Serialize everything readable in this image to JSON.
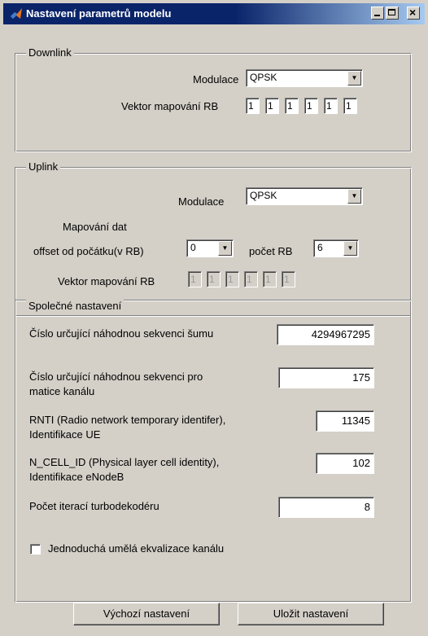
{
  "window": {
    "title": "Nastavení parametrů modelu",
    "icon": "matlab-icon"
  },
  "downlink": {
    "legend": "Downlink",
    "modulation_label": "Modulace",
    "modulation_value": "QPSK",
    "vector_label": "Vektor mapování RB",
    "vector": [
      "1",
      "1",
      "1",
      "1",
      "1",
      "1"
    ]
  },
  "uplink": {
    "legend": "Uplink",
    "modulation_label": "Modulace",
    "modulation_value": "QPSK",
    "mapping_title": "Mapování dat",
    "offset_label": "offset od počátku(v RB)",
    "offset_value": "0",
    "count_label": "počet RB",
    "count_value": "6",
    "vector_label": "Vektor mapování RB",
    "vector": [
      "1",
      "1",
      "1",
      "1",
      "1",
      "1"
    ]
  },
  "common": {
    "legend": "Společné nastavení",
    "noise_seed_label": "Číslo určující náhodnou sekvenci šumu",
    "noise_seed_value": "4294967295",
    "channel_seed_label_1": "Číslo určující náhodnou sekvenci pro",
    "channel_seed_label_2": "matice kanálu",
    "channel_seed_value": "175",
    "rnti_label_1": "RNTI (Radio network temporary identifer),",
    "rnti_label_2": "Identifikace UE",
    "rnti_value": "11345",
    "cellid_label_1": "N_CELL_ID (Physical layer cell identity),",
    "cellid_label_2": "Identifikace eNodeB",
    "cellid_value": "102",
    "iterations_label": "Počet iterací turbodekodéru",
    "iterations_value": "8",
    "equalization_label": "Jednoduchá umělá ekvalizace kanálu",
    "equalization_checked": false
  },
  "buttons": {
    "default_label": "Výchozí nastavení",
    "save_label": "Uložit nastavení"
  }
}
